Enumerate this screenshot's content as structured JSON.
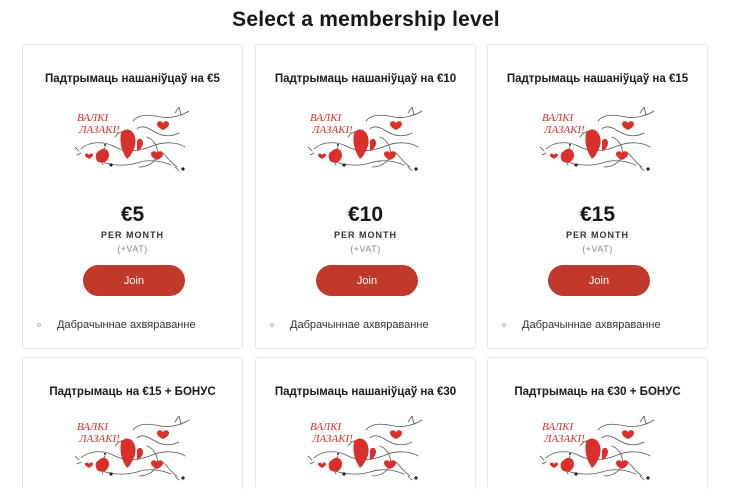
{
  "page": {
    "title": "Select a membership level"
  },
  "tiers": [
    {
      "title": "Падтрымаць нашаніўцаў на €5",
      "price": "€5",
      "period": "PER MONTH",
      "vat": "(+VAT)",
      "join_label": "Join",
      "benefit": "Дабрачыннае ахвяраванне"
    },
    {
      "title": "Падтрымаць нашаніўцаў на €10",
      "price": "€10",
      "period": "PER MONTH",
      "vat": "(+VAT)",
      "join_label": "Join",
      "benefit": "Дабрачыннае ахвяраванне"
    },
    {
      "title": "Падтрымаць нашаніўцаў на €15",
      "price": "€15",
      "period": "PER MONTH",
      "vat": "(+VAT)",
      "join_label": "Join",
      "benefit": "Дабрачыннае ахвяраванне"
    },
    {
      "title": "Падтрымаць на €15 + БОНУС"
    },
    {
      "title": "Падтрымаць нашаніўцаў на €30"
    },
    {
      "title": "Падтрымаць на €30 + БОНУС"
    }
  ],
  "artwork": {
    "lettering": "Валкі лазакі!",
    "accent": "#d9302b",
    "line": "#555555"
  },
  "colors": {
    "button": "#c0392b",
    "border": "#e6e6e6"
  }
}
